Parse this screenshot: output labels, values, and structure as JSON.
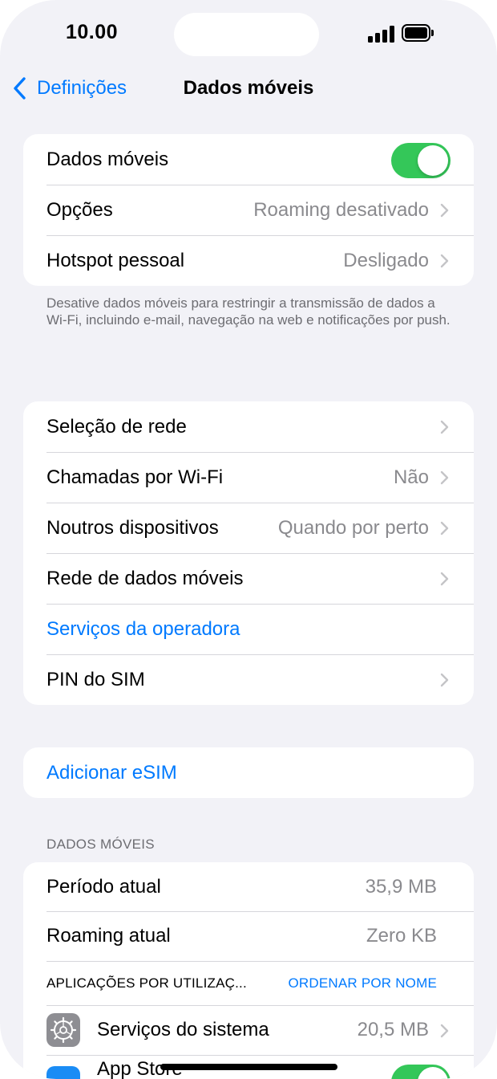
{
  "status_bar": {
    "time": "10.00"
  },
  "nav": {
    "back_label": "Definições",
    "title": "Dados móveis"
  },
  "group1": {
    "rows": [
      {
        "label": "Dados móveis"
      },
      {
        "label": "Opções",
        "value": "Roaming desativado"
      },
      {
        "label": "Hotspot pessoal",
        "value": "Desligado"
      }
    ],
    "toggle_on": true,
    "footer": "Desative dados móveis para restringir a transmissão de dados a Wi-Fi, incluindo e-mail, navegação na web e notificações por push."
  },
  "group2": {
    "rows": [
      {
        "label": "Seleção de rede"
      },
      {
        "label": "Chamadas por Wi-Fi",
        "value": "Não"
      },
      {
        "label": "Noutros dispositivos",
        "value": "Quando por perto"
      },
      {
        "label": "Rede de dados móveis"
      },
      {
        "label": "Serviços da operadora"
      },
      {
        "label": "PIN do SIM"
      }
    ]
  },
  "group3": {
    "add_esim": "Adicionar eSIM"
  },
  "usage": {
    "header": "DADOS MÓVEIS",
    "current_period_label": "Período atual",
    "current_period_value": "35,9 MB",
    "roaming_label": "Roaming atual",
    "roaming_value": "Zero KB",
    "apps_header": "APLICAÇÕES POR UTILIZAÇ...",
    "sort_label": "ORDENAR POR NOME",
    "apps": [
      {
        "name": "Serviços do sistema",
        "value": "20,5 MB",
        "icon": "settings-gear-icon"
      },
      {
        "name": "App Store",
        "icon": "app-store-icon",
        "toggle_on": true
      }
    ]
  },
  "colors": {
    "accent": "#007aff",
    "toggle_on": "#34c759",
    "background": "#f2f2f7"
  }
}
